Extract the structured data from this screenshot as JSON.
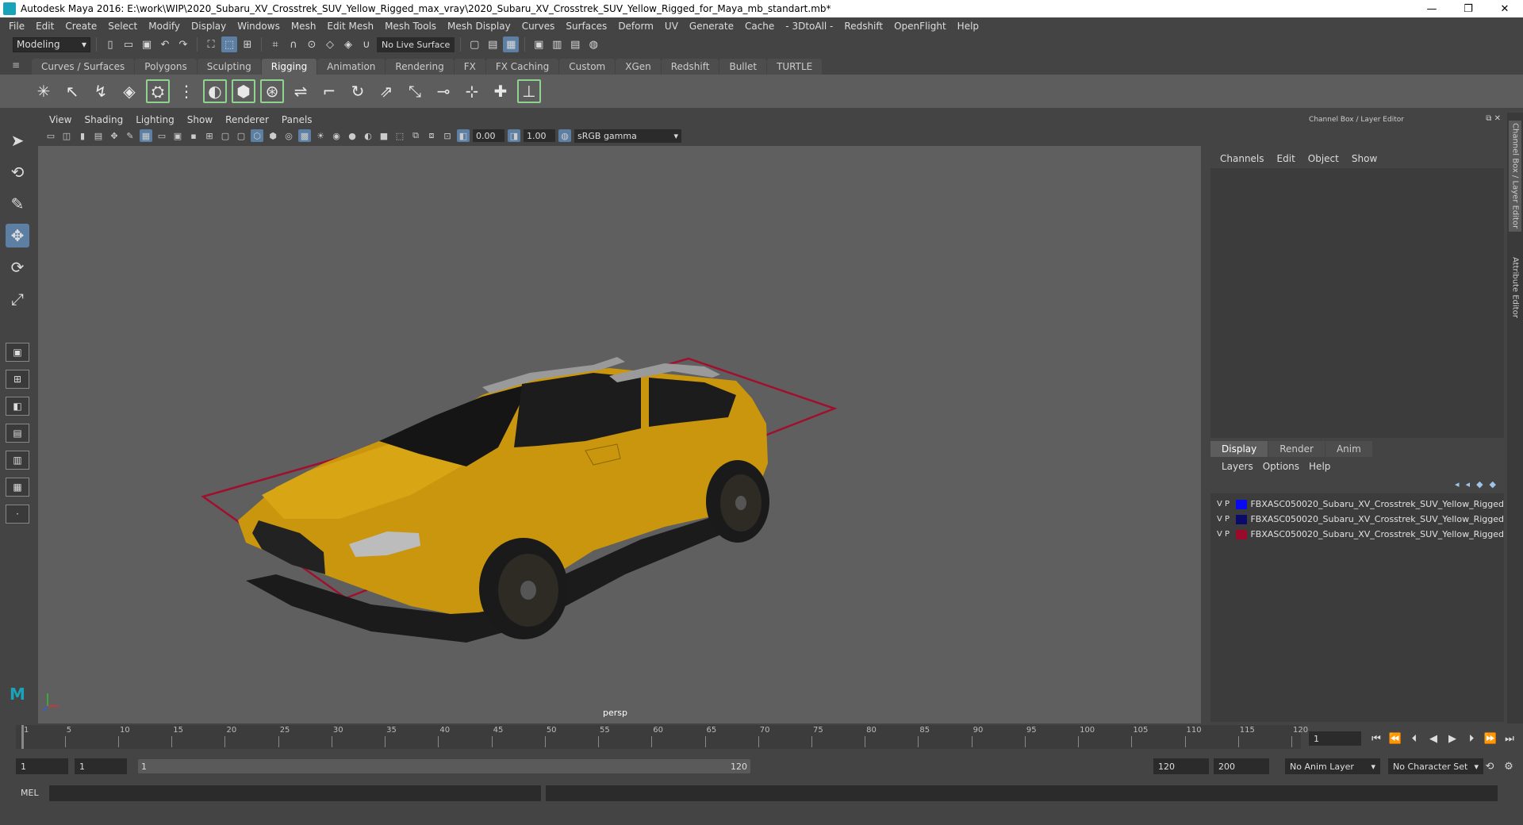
{
  "window": {
    "title": "Autodesk Maya 2016: E:\\work\\WIP\\2020_Subaru_XV_Crosstrek_SUV_Yellow_Rigged_max_vray\\2020_Subaru_XV_Crosstrek_SUV_Yellow_Rigged_for_Maya_mb_standart.mb*",
    "minimize": "—",
    "restore": "❐",
    "close": "✕"
  },
  "menubar": [
    "File",
    "Edit",
    "Create",
    "Select",
    "Modify",
    "Display",
    "Windows",
    "Mesh",
    "Edit Mesh",
    "Mesh Tools",
    "Mesh Display",
    "Curves",
    "Surfaces",
    "Deform",
    "UV",
    "Generate",
    "Cache",
    "- 3DtoAll -",
    "Redshift",
    "OpenFlight",
    "Help"
  ],
  "statusline": {
    "mode": "Modeling",
    "live_surface": "No Live Surface"
  },
  "shelf_tabs": [
    "Curves / Surfaces",
    "Polygons",
    "Sculpting",
    "Rigging",
    "Animation",
    "Rendering",
    "FX",
    "FX Caching",
    "Custom",
    "XGen",
    "Redshift",
    "Bullet",
    "TURTLE"
  ],
  "shelf_active": "Rigging",
  "viewport": {
    "menu": [
      "View",
      "Shading",
      "Lighting",
      "Show",
      "Renderer",
      "Panels"
    ],
    "exposure": "0.00",
    "gamma": "1.00",
    "color_space": "sRGB gamma",
    "camera_label": "persp"
  },
  "right_panel": {
    "title": "Channel Box / Layer Editor",
    "channel_menu": [
      "Channels",
      "Edit",
      "Object",
      "Show"
    ],
    "layer_tabs": [
      "Display",
      "Render",
      "Anim"
    ],
    "layer_active_tab": "Display",
    "layer_menu": [
      "Layers",
      "Options",
      "Help"
    ],
    "layers": [
      {
        "v": "V",
        "p": "P",
        "color": "#0a0af0",
        "name": "FBXASC050020_Subaru_XV_Crosstrek_SUV_Yellow_Rigged"
      },
      {
        "v": "V",
        "p": "P",
        "color": "#0a0a6a",
        "name": "FBXASC050020_Subaru_XV_Crosstrek_SUV_Yellow_Rigged"
      },
      {
        "v": "V",
        "p": "P",
        "color": "#9b0a2a",
        "name": "FBXASC050020_Subaru_XV_Crosstrek_SUV_Yellow_Rigged"
      }
    ],
    "side_tabs": [
      "Channel Box / Layer Editor",
      "Attribute Editor"
    ]
  },
  "timeline": {
    "labels": [
      "1",
      "5",
      "10",
      "15",
      "20",
      "25",
      "30",
      "35",
      "40",
      "45",
      "50",
      "55",
      "60",
      "65",
      "70",
      "75",
      "80",
      "85",
      "90",
      "95",
      "100",
      "105",
      "110",
      "115",
      "120"
    ],
    "current_frame": "1"
  },
  "range": {
    "start": "1",
    "playback_start": "1",
    "slider_start": "1",
    "slider_end": "120",
    "playback_end": "120",
    "end": "200",
    "anim_layer": "No Anim Layer",
    "character_set": "No Character Set"
  },
  "cmdline": {
    "label": "MEL"
  },
  "colors": {
    "car_body": "#c9960d",
    "ground_box": "#a0102e",
    "viewport_bg": "#5f5f5f",
    "accent": "#5c7fa3"
  }
}
